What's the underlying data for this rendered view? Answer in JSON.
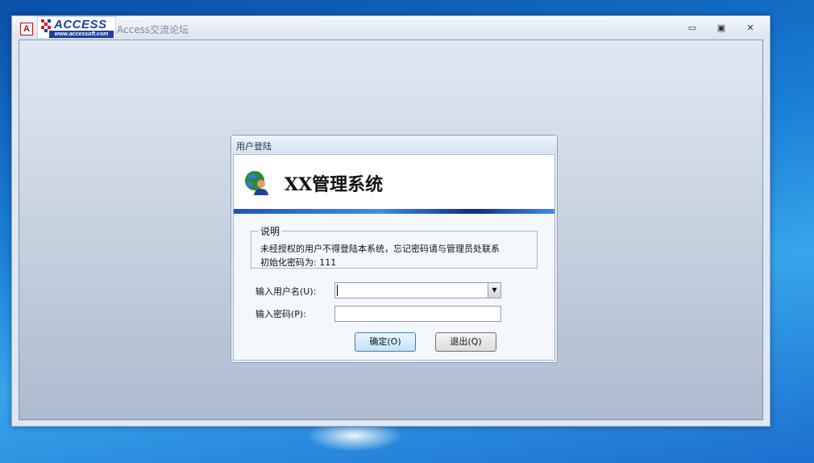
{
  "window": {
    "app_icon_letter": "A",
    "logo_text": "ACCESS",
    "logo_url_text": "www.accessoft.com",
    "title": "Access交流论坛",
    "controls": {
      "minimize": "▭",
      "maximize": "▣",
      "close": "✕"
    }
  },
  "dialog": {
    "title": "用户登陆",
    "system_name": "XX管理系统",
    "notice": {
      "label": "说明",
      "line1": "未经授权的用户不得登陆本系统，忘记密码请与管理员处联系",
      "line2": "初始化密码为: 111"
    },
    "username_label": "输入用户名(U):",
    "username_value": "",
    "password_label": "输入密码(P):",
    "password_value": "",
    "ok_button": "确定(O)",
    "exit_button": "退出(Q)"
  },
  "colors": {
    "accent_blue": "#1b55b8",
    "logo_blue": "#1c3fa0"
  }
}
